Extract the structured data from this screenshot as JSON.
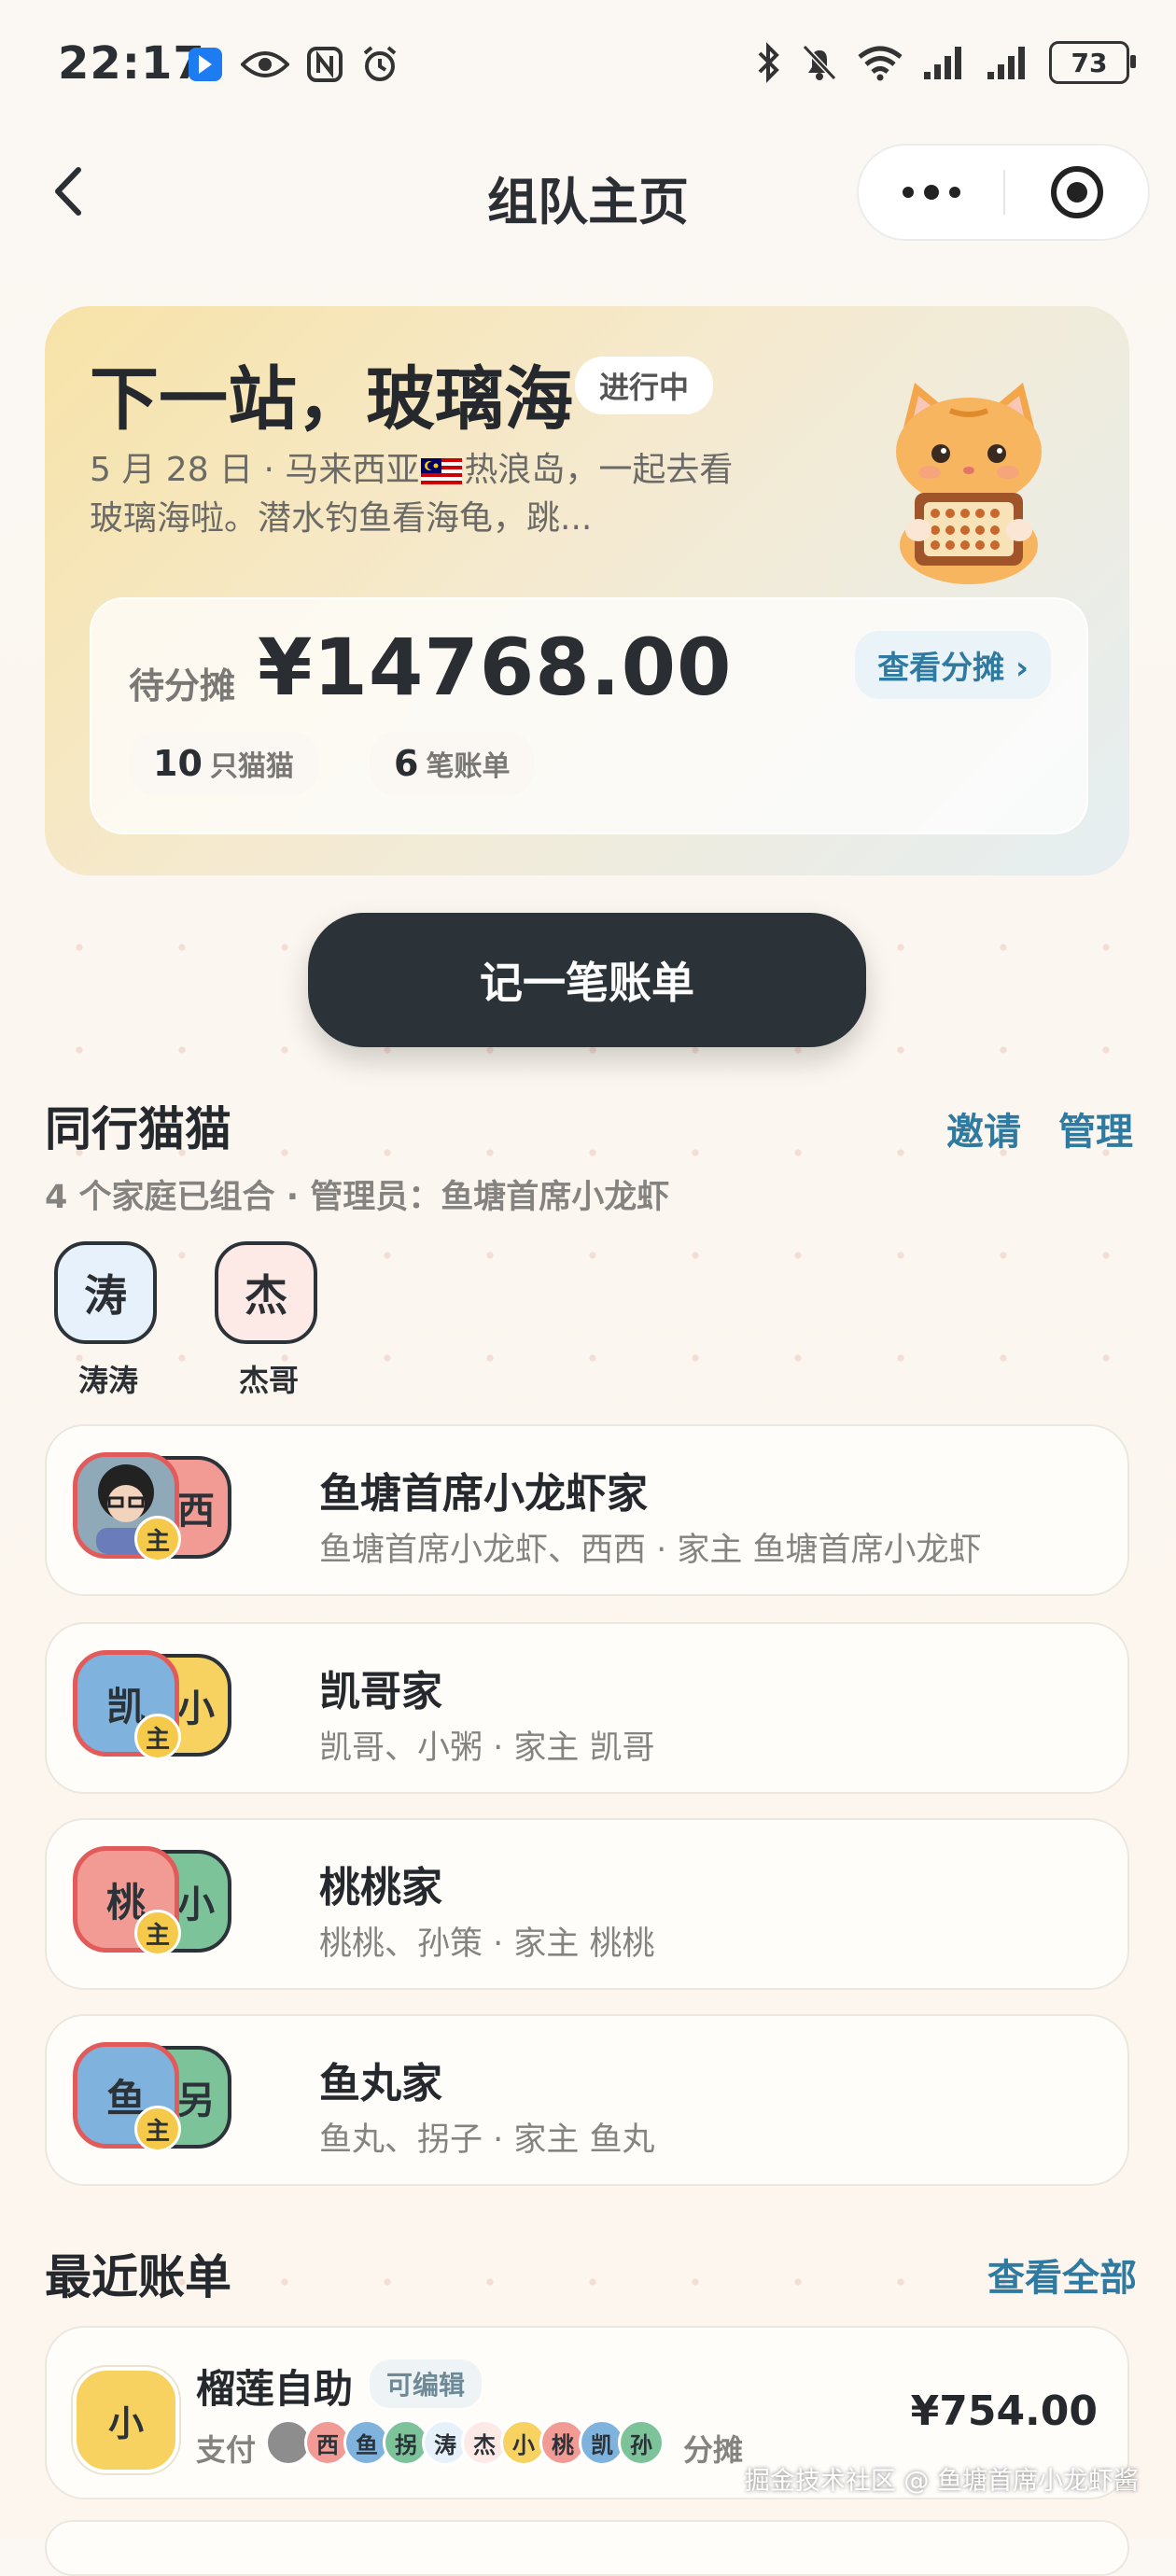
{
  "status": {
    "time": "22:17",
    "battery": "73"
  },
  "nav": {
    "title": "组队主页"
  },
  "hero": {
    "title": "下一站，玻璃海",
    "status": "进行中",
    "desc_1": "5 月 28 日 · 马来西亚",
    "desc_2": "热浪岛，一起去看玻璃海啦。潜水钓鱼看海龟，跳...",
    "pending_label": "待分摊",
    "pending_amount": "¥14768.00",
    "view_split": "查看分摊 ›",
    "cats_count": "10",
    "cats_label": "只猫猫",
    "bills_count": "6",
    "bills_label": "笔账单"
  },
  "record_button": "记一笔账单",
  "companions": {
    "title": "同行猫猫",
    "invite": "邀请",
    "manage": "管理",
    "subtitle": "4 个家庭已组合 · 管理员：鱼塘首席小龙虾",
    "members": [
      {
        "char": "涛",
        "name": "涛涛",
        "bg": "#e6f1fb"
      },
      {
        "char": "杰",
        "name": "杰哥",
        "bg": "#fde9e6"
      }
    ]
  },
  "families": [
    {
      "name": "鱼塘首席小龙虾家",
      "sub": "鱼塘首席小龙虾、西西 · 家主 鱼塘首席小龙虾",
      "av1": "",
      "av1_bg": "#9a9a9a",
      "av2": "西",
      "av2_bg": "#f29a94",
      "badge": "主"
    },
    {
      "name": "凯哥家",
      "sub": "凯哥、小粥 · 家主 凯哥",
      "av1": "凯",
      "av1_bg": "#7fb3de",
      "av2": "小",
      "av2_bg": "#f7d260",
      "badge": "主"
    },
    {
      "name": "桃桃家",
      "sub": "桃桃、孙策 · 家主 桃桃",
      "av1": "桃",
      "av1_bg": "#f29a94",
      "av2": "小",
      "av2_bg": "#7cc39a",
      "badge": "主"
    },
    {
      "name": "鱼丸家",
      "sub": "鱼丸、拐子 · 家主 鱼丸",
      "av1": "鱼",
      "av1_bg": "#7fb3de",
      "av2": "另",
      "av2_bg": "#7cc39a",
      "badge": "主"
    }
  ],
  "recent": {
    "title": "最近账单",
    "view_all": "查看全部",
    "bills": [
      {
        "avatar": "小",
        "title": "榴莲自助",
        "tag": "可编辑",
        "payer_label": "支付",
        "participants": [
          {
            "c": "",
            "bg": "#8d8d8d"
          },
          {
            "c": "西",
            "bg": "#f29a94"
          },
          {
            "c": "鱼",
            "bg": "#7fb3de"
          },
          {
            "c": "拐",
            "bg": "#7cc39a"
          },
          {
            "c": "涛",
            "bg": "#e6f1fb"
          },
          {
            "c": "杰",
            "bg": "#fde9e6"
          },
          {
            "c": "小",
            "bg": "#f7d260"
          },
          {
            "c": "桃",
            "bg": "#f29a94"
          },
          {
            "c": "凯",
            "bg": "#7fb3de"
          },
          {
            "c": "孙",
            "bg": "#7cc39a"
          }
        ],
        "split_label": "分摊",
        "amount": "¥754.00"
      }
    ]
  },
  "watermark": "掘金技术社区 @ 鱼塘首席小龙虾酱"
}
